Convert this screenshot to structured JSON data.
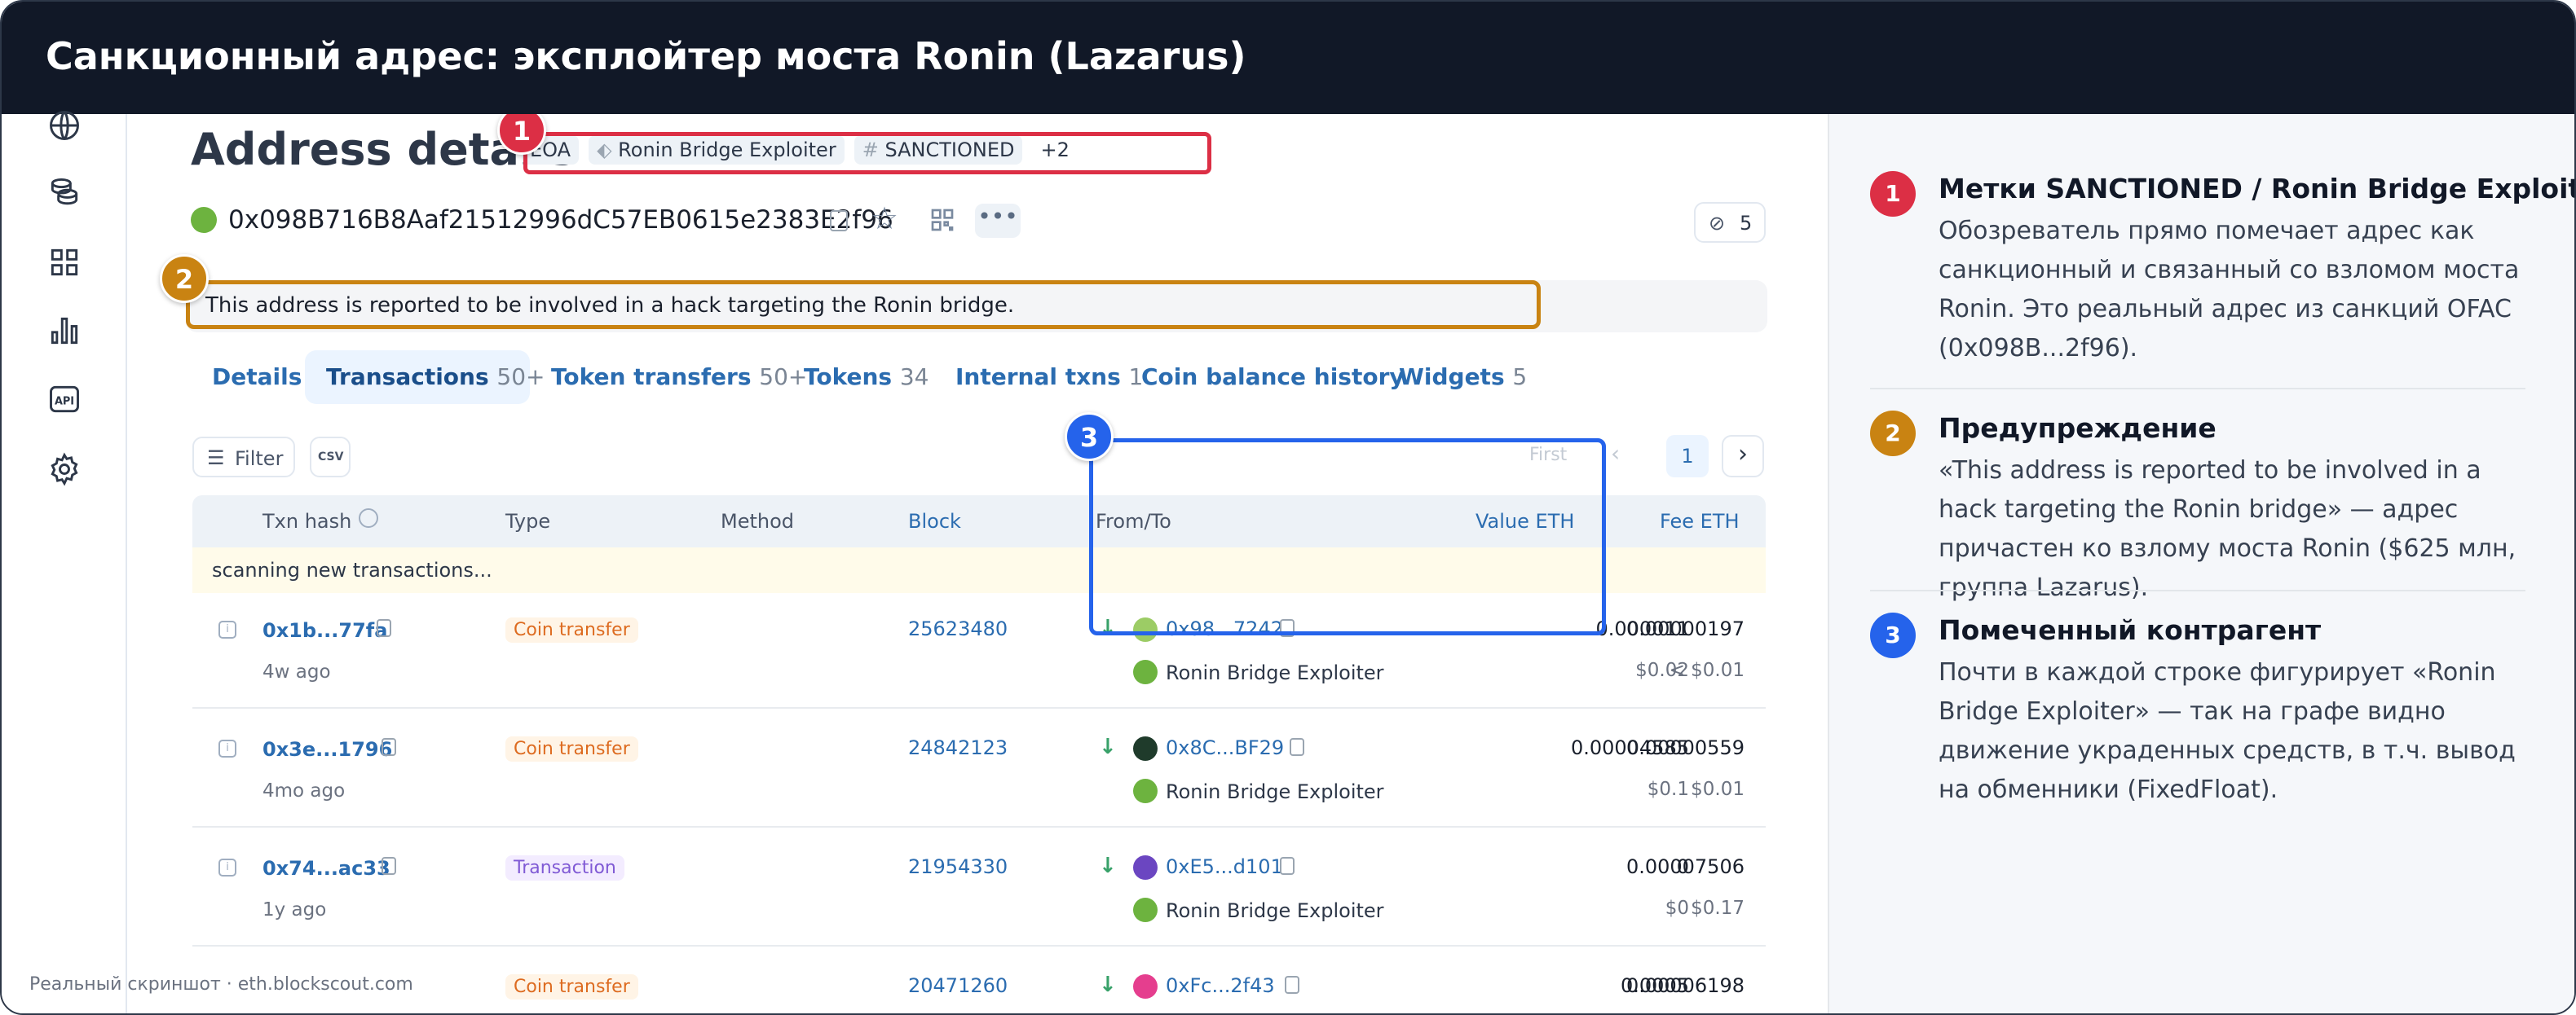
{
  "title": "Санкционный адрес: эксплойтер моста Ronin (Lazarus)",
  "colors": {
    "header_bg": "#111827",
    "link": "#2b6cb0",
    "annot_red": "#dc2f45",
    "annot_orange": "#c98312",
    "annot_blue": "#2563eb"
  },
  "page": {
    "heading": "Address details",
    "tags": [
      "EOA",
      "Ronin Bridge Exploiter",
      "SANCTIONED",
      "+2"
    ],
    "address": "0x098B716B8Aaf21512996dC57EB0615e2383E2f96",
    "counter": "5",
    "warning": "This address is reported to be involved in a hack targeting the Ronin bridge."
  },
  "tabs": [
    {
      "label": "Details",
      "count": ""
    },
    {
      "label": "Transactions",
      "count": "50+"
    },
    {
      "label": "Token transfers",
      "count": "50+"
    },
    {
      "label": "Tokens",
      "count": "34"
    },
    {
      "label": "Internal txns",
      "count": "1"
    },
    {
      "label": "Coin balance history",
      "count": ""
    },
    {
      "label": "Widgets",
      "count": "5"
    }
  ],
  "toolbar": {
    "filter": "Filter",
    "csv": "CSV",
    "first": "First",
    "page": "1"
  },
  "table": {
    "headers": [
      "Txn hash",
      "Type",
      "Method",
      "Block",
      "From/To",
      "Value ETH",
      "Fee ETH"
    ],
    "scanning": "scanning new transactions...",
    "rows": [
      {
        "hash": "0x1b...77fa",
        "age": "4w ago",
        "type": "Coin transfer",
        "block": "25623480",
        "from": "0x98...7242",
        "to": "Ronin Bridge Exploiter",
        "value": "0.000011",
        "value_usd": "$0.02",
        "fee": "0.00000197",
        "fee_usd": "< $0.01"
      },
      {
        "hash": "0x3e...1796",
        "age": "4mo ago",
        "type": "Coin transfer",
        "block": "24842123",
        "from": "0x8C...BF29",
        "to": "Ronin Bridge Exploiter",
        "value": "0.00004585",
        "value_usd": "$0.1",
        "fee": "0.00000559",
        "fee_usd": "$0.01"
      },
      {
        "hash": "0x74...ac33",
        "age": "1y ago",
        "type": "Transaction",
        "block": "21954330",
        "from": "0xE5...d101",
        "to": "Ronin Bridge Exploiter",
        "value": "0",
        "value_usd": "$0",
        "fee": "0.00007506",
        "fee_usd": "$0.17"
      },
      {
        "hash": "",
        "age": "",
        "type": "Coin transfer",
        "block": "20471260",
        "from": "0xFc...2f43",
        "to": "",
        "value": "0.0005",
        "value_usd": "",
        "fee": "0.00006198",
        "fee_usd": ""
      }
    ]
  },
  "annotations": [
    {
      "num": "1",
      "title": "Метки SANCTIONED / Ronin Bridge Exploiter",
      "body": "Обозреватель прямо помечает адрес как санкционный и связанный со взломом моста Ronin. Это реальный адрес из санкций OFAC (0x098B...2f96)."
    },
    {
      "num": "2",
      "title": "Предупреждение",
      "body": "«This address is reported to be involved in a hack targeting the Ronin bridge» — адрес причастен ко взлому моста Ronin ($625 млн, группа Lazarus)."
    },
    {
      "num": "3",
      "title": "Помеченный контрагент",
      "body": "Почти в каждой строке фигурирует «Ronin Bridge Exploiter» — так на графе видно движение украденных средств, в т.ч. вывод на обменники (FixedFloat)."
    }
  ],
  "footer": "Реальный скриншот · eth.blockscout.com"
}
